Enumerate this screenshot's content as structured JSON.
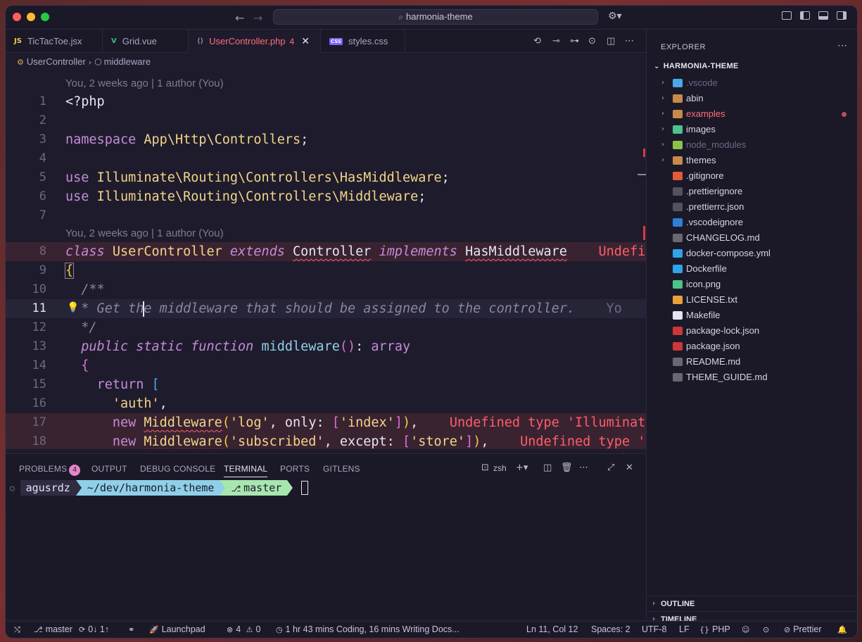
{
  "titlebar": {
    "search_text": "harmonia-theme"
  },
  "tabs": [
    {
      "icon": "JS",
      "label": "TicTacToe.jsx",
      "icon_color": "#f7c948"
    },
    {
      "icon": "V",
      "label": "Grid.vue",
      "icon_color": "#41b883"
    },
    {
      "icon": "⟨⟩",
      "label": "UserController.php",
      "badge": "4",
      "icon_color": "#8892bf"
    },
    {
      "icon": "CSS",
      "label": "styles.css",
      "icon_color": "#7b61ff"
    }
  ],
  "breadcrumb": {
    "class": "UserController",
    "method": "middleware"
  },
  "editor": {
    "codelens_top": "You, 2 weeks ago | 1 author (You)",
    "codelens_class": "You, 2 weeks ago | 1 author (You)",
    "lines": [
      {
        "n": "1",
        "t1": "<?php"
      },
      {
        "n": "2"
      },
      {
        "n": "3",
        "kw": "namespace",
        "ns": "App\\Http\\Controllers",
        "end": ";"
      },
      {
        "n": "4"
      },
      {
        "n": "5",
        "kw": "use",
        "ns": "Illuminate\\Routing\\Controllers\\HasMiddleware",
        "end": ";"
      },
      {
        "n": "6",
        "kw": "use",
        "ns": "Illuminate\\Routing\\Controllers\\Middleware",
        "end": ";"
      },
      {
        "n": "7"
      },
      {
        "n": "8",
        "kw1": "class",
        "name": "UserController",
        "kw2": "extends",
        "parent": "Controller",
        "kw3": "implements",
        "iface": "HasMiddleware",
        "diag": "Undefi"
      },
      {
        "n": "9",
        "t1": "{"
      },
      {
        "n": "10",
        "t1": "/**"
      },
      {
        "n": "11",
        "t1": "* Get th",
        "t2": "e middleware that should be assigned to the controller.",
        "ghost": "Yo"
      },
      {
        "n": "12",
        "t1": "*/"
      },
      {
        "n": "13",
        "kw1": "public",
        "kw2": "static",
        "kw3": "function",
        "fn": "middleware",
        "p": "(): ",
        "ret": "array"
      },
      {
        "n": "14",
        "t1": "{"
      },
      {
        "n": "15",
        "kw": "return",
        "t1": "["
      },
      {
        "n": "16",
        "str": "'auth'",
        "end": ","
      },
      {
        "n": "17",
        "kw": "new",
        "cls": "Middleware",
        "a1": "'log'",
        "a2": ", only: ",
        "a3": "'index'",
        "end": "),",
        "diag": "Undefined type 'Illuminat"
      },
      {
        "n": "18",
        "kw": "new",
        "cls": "Middleware",
        "a1": "'subscribed'",
        "a2": ", except: ",
        "a3": "'store'",
        "end": "),",
        "diag": "Undefined type '"
      }
    ]
  },
  "panel": {
    "tabs": [
      "PROBLEMS",
      "OUTPUT",
      "DEBUG CONSOLE",
      "TERMINAL",
      "PORTS",
      "GITLENS"
    ],
    "problems_count": "4",
    "shell": "zsh",
    "prompt_user": "agusrdz",
    "prompt_path": "~/dev/harmonia-theme",
    "prompt_branch": "master"
  },
  "sidebar": {
    "title": "EXPLORER",
    "root": "HARMONIA-THEME",
    "items": [
      {
        "name": ".vscode",
        "folder": true,
        "dim": true,
        "color": "#4aa8e8"
      },
      {
        "name": "abin",
        "folder": true,
        "color": "#c78a4a"
      },
      {
        "name": "examples",
        "folder": true,
        "modified": true,
        "color": "#c78a4a"
      },
      {
        "name": "images",
        "folder": true,
        "color": "#4cc38a"
      },
      {
        "name": "node_modules",
        "folder": true,
        "dim": true,
        "color": "#8bc34a"
      },
      {
        "name": "themes",
        "folder": true,
        "color": "#c78a4a"
      },
      {
        "name": ".gitignore",
        "color": "#e45a3a"
      },
      {
        "name": ".prettierignore",
        "color": "#56515f"
      },
      {
        "name": ".prettierrc.json",
        "color": "#56515f"
      },
      {
        "name": ".vscodeignore",
        "color": "#2f7fd8"
      },
      {
        "name": "CHANGELOG.md",
        "color": "#6b6770"
      },
      {
        "name": "docker-compose.yml",
        "color": "#2fa4e8"
      },
      {
        "name": "Dockerfile",
        "color": "#2fa4e8"
      },
      {
        "name": "icon.png",
        "color": "#4cc38a"
      },
      {
        "name": "LICENSE.txt",
        "color": "#e8a03a"
      },
      {
        "name": "Makefile",
        "color": "#e6e3f2"
      },
      {
        "name": "package-lock.json",
        "color": "#cb3837"
      },
      {
        "name": "package.json",
        "color": "#cb3837"
      },
      {
        "name": "README.md",
        "color": "#6b6770"
      },
      {
        "name": "THEME_GUIDE.md",
        "color": "#6b6770"
      }
    ],
    "outline": "OUTLINE",
    "timeline": "TIMELINE"
  },
  "statusbar": {
    "branch": "master",
    "sync": "0↓ 1↑",
    "launchpad": "Launchpad",
    "errors": "4",
    "warnings": "0",
    "wakatime": "1 hr 43 mins Coding, 16 mins Writing Docs...",
    "position": "Ln 11, Col 12",
    "spaces": "Spaces: 2",
    "encoding": "UTF-8",
    "eol": "LF",
    "language": "PHP",
    "formatter": "Prettier"
  }
}
